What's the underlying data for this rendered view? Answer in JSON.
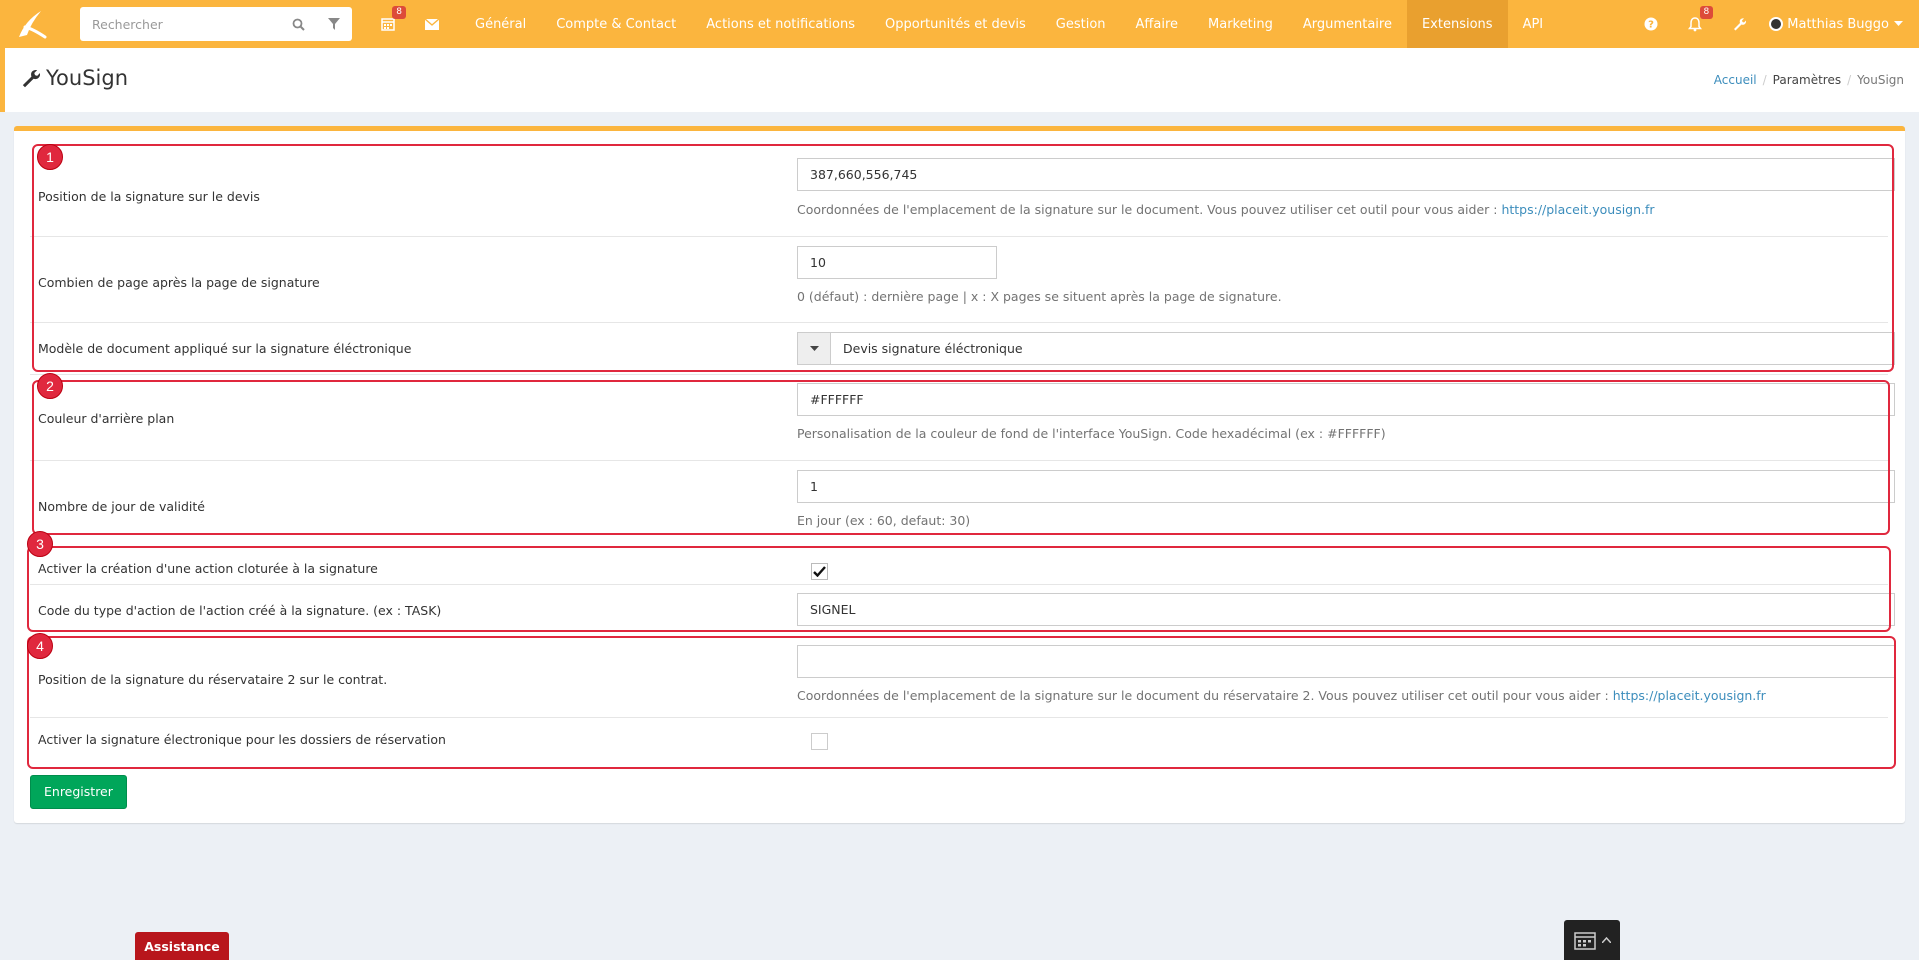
{
  "navbar": {
    "search_placeholder": "Rechercher",
    "calendar_badge": "8",
    "notif_badge": "8",
    "menu": [
      "Général",
      "Compte & Contact",
      "Actions et notifications",
      "Opportunités et devis",
      "Gestion",
      "Affaire",
      "Marketing",
      "Argumentaire",
      "Extensions",
      "API"
    ],
    "active_menu": "Extensions",
    "user_name": "Matthias Buggo"
  },
  "header": {
    "title": "YouSign",
    "breadcrumb": [
      "Accueil",
      "Paramètres",
      "YouSign"
    ]
  },
  "annotations": [
    "1",
    "2",
    "3",
    "4"
  ],
  "fields": {
    "signature_position": {
      "label": "Position de la signature sur le devis",
      "value": "387,660,556,745",
      "help": "Coordonnées de l'emplacement de la signature sur le document. Vous pouvez utiliser cet outil pour vous aider : ",
      "link": "https://placeit.yousign.fr"
    },
    "pages_after": {
      "label": "Combien de page après la page de signature",
      "value": "10",
      "help": "0 (défaut) : dernière page | x : X pages se situent après la page de signature."
    },
    "doc_model": {
      "label": "Modèle de document appliqué sur la signature éléctronique",
      "value": "Devis signature éléctronique"
    },
    "bg_color": {
      "label": "Couleur d'arrière plan",
      "value": "#FFFFFF",
      "help": "Personalisation de la couleur de fond de l'interface YouSign. Code hexadécimal (ex : #FFFFFF)"
    },
    "validity_days": {
      "label": "Nombre de jour de validité",
      "value": "1",
      "help": "En jour (ex : 60, defaut: 30)"
    },
    "closed_action": {
      "label": "Activer la création d'une action cloturée à la signature",
      "checked": true
    },
    "action_type": {
      "label": "Code du type d'action de l'action créé à la signature. (ex : TASK)",
      "value": "SIGNEL"
    },
    "reservataire_position": {
      "label": "Position de la signature du réservataire 2 sur le contrat.",
      "value": "",
      "help": "Coordonnées de l'emplacement de la signature sur le document du réservataire 2. Vous pouvez utiliser cet outil pour vous aider : ",
      "link": "https://placeit.yousign.fr"
    },
    "reservation_esign": {
      "label": "Activer la signature électronique pour les dossiers de réservation",
      "checked": false
    }
  },
  "buttons": {
    "save": "Enregistrer",
    "assistance": "Assistance"
  },
  "colors": {
    "brand": "#fbb53e",
    "save": "#00a65a",
    "annotation": "#e0283e"
  }
}
